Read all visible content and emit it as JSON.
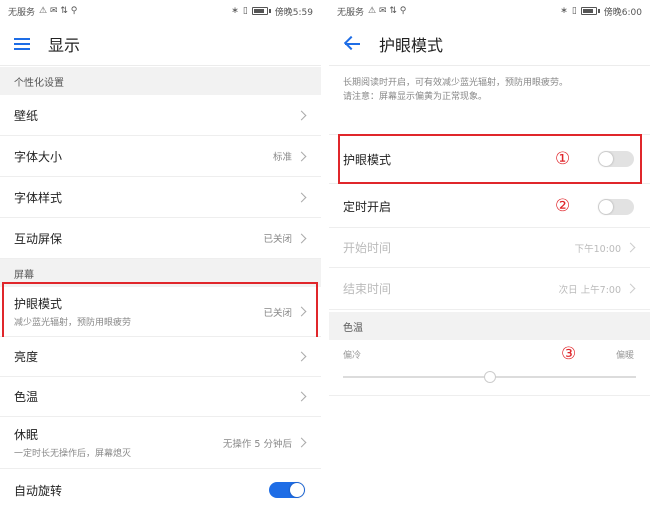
{
  "left": {
    "status": {
      "carrier": "无服务",
      "time": "傍晚5:59"
    },
    "title": "显示",
    "sections": {
      "personal": "个性化设置",
      "screen": "屏幕"
    },
    "items": {
      "wallpaper": {
        "label": "壁纸"
      },
      "font_size": {
        "label": "字体大小",
        "value": "标准"
      },
      "font_style": {
        "label": "字体样式"
      },
      "screensaver": {
        "label": "互动屏保",
        "value": "已关闭"
      },
      "eye_comfort": {
        "label": "护眼模式",
        "sub": "减少蓝光辐射，预防用眼疲劳",
        "value": "已关闭"
      },
      "brightness": {
        "label": "亮度"
      },
      "color_temp": {
        "label": "色温"
      },
      "sleep": {
        "label": "休眠",
        "sub": "一定时长无操作后，屏幕熄灭",
        "value": "无操作 5 分钟后"
      },
      "auto_rotate": {
        "label": "自动旋转",
        "on": true
      }
    }
  },
  "right": {
    "status": {
      "carrier": "无服务",
      "time": "傍晚6:00"
    },
    "title": "护眼模式",
    "description_1": "长期阅读时开启，可有效减少蓝光辐射，预防用眼疲劳。",
    "description_2": "请注意：屏幕显示偏黄为正常现象。",
    "items": {
      "eye_comfort": {
        "label": "护眼模式",
        "on": false,
        "marker": "①"
      },
      "scheduled": {
        "label": "定时开启",
        "on": false,
        "marker": "②"
      },
      "start_time": {
        "label": "开始时间",
        "value": "下午10:00"
      },
      "end_time": {
        "label": "结束时间",
        "value": "次日 上午7:00"
      }
    },
    "color_temp": {
      "header": "色温",
      "cool_label": "偏冷",
      "warm_label": "偏暖",
      "marker": "③",
      "level": 0.5
    }
  },
  "colors": {
    "accent": "#1e6de6",
    "highlight": "#e0262b"
  }
}
